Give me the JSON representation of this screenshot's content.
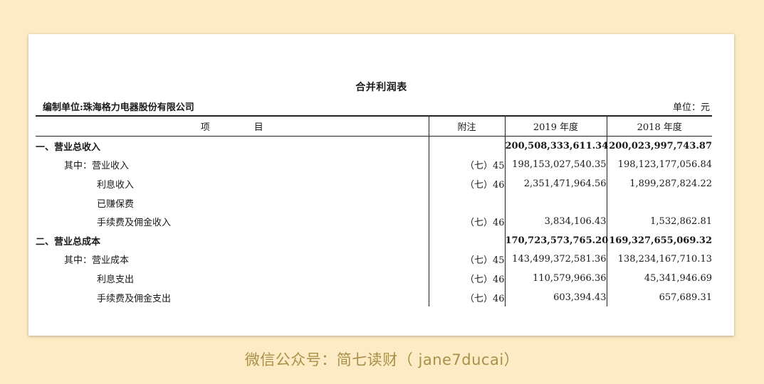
{
  "document": {
    "title": "合并利润表",
    "compiler": "编制单位:珠海格力电器股份有限公司",
    "unit": "单位：元"
  },
  "table": {
    "headers": {
      "item_char1": "项",
      "item_char2": "目",
      "note": "附注",
      "y2019": "2019 年度",
      "y2018": "2018 年度"
    },
    "rows": [
      {
        "label": "一、营业总收入",
        "note": "",
        "y2019": "200,508,333,611.34",
        "y2018": "200,023,997,743.87"
      },
      {
        "label": "其中：营业收入",
        "note": "（七）45",
        "y2019": "198,153,027,540.35",
        "y2018": "198,123,177,056.84"
      },
      {
        "label": "利息收入",
        "note": "（七）46",
        "y2019": "2,351,471,964.56",
        "y2018": "1,899,287,824.22"
      },
      {
        "label": "已赚保费",
        "note": "",
        "y2019": "",
        "y2018": ""
      },
      {
        "label": "手续费及佣金收入",
        "note": "（七）46",
        "y2019": "3,834,106.43",
        "y2018": "1,532,862.81"
      },
      {
        "label": "二、营业总成本",
        "note": "",
        "y2019": "170,723,573,765.20",
        "y2018": "169,327,655,069.32"
      },
      {
        "label": "其中：营业成本",
        "note": "（七）45",
        "y2019": "143,499,372,581.36",
        "y2018": "138,234,167,710.13"
      },
      {
        "label": "利息支出",
        "note": "（七）46",
        "y2019": "110,579,966.36",
        "y2018": "45,341,946.69"
      },
      {
        "label": "手续费及佣金支出",
        "note": "（七）46",
        "y2019": "603,394.43",
        "y2018": "657,689.31"
      }
    ]
  },
  "watermark": "微信公众号：简七读财（ jane7ducai）"
}
